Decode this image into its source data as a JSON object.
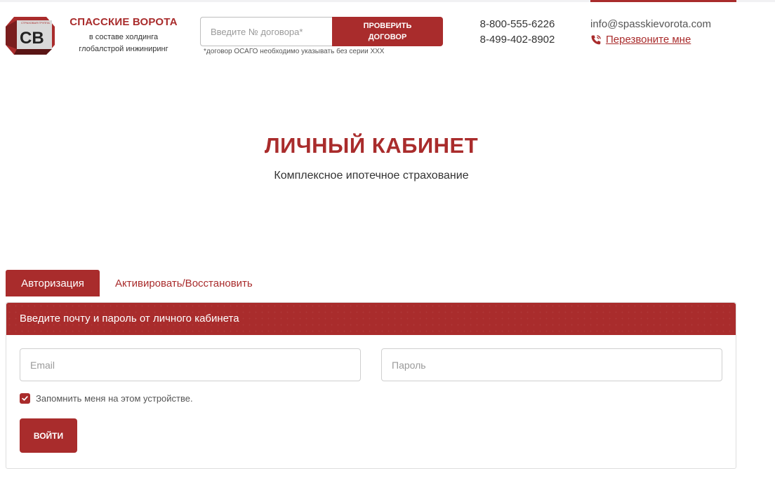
{
  "brand": {
    "logo_text": "СВ",
    "logo_small": "СТРАХОВАЯ ГРУППА",
    "title": "СПАССКИЕ ВОРОТА",
    "subtitle_line1": "в составе холдинга",
    "subtitle_line2": "глобалстрой инжиниринг",
    "color": "#a92c2c"
  },
  "contract_check": {
    "placeholder": "Введите № договора*",
    "button_line1": "ПРОВЕРИТЬ",
    "button_line2": "ДОГОВОР",
    "note": "*договор ОСАГО необходимо указывать без серии ХХХ"
  },
  "contacts": {
    "phone1": "8-800-555-6226",
    "phone2": "8-499-402-8902",
    "email": "info@spasskievorota.com",
    "callback_label": "Перезвоните мне",
    "callback_icon": "phone-icon"
  },
  "page": {
    "title": "ЛИЧНЫЙ КАБИНЕТ",
    "subtitle": "Комплексное ипотечное страхование"
  },
  "tabs": [
    {
      "label": "Авторизация",
      "active": true
    },
    {
      "label": "Активировать/Восстановить",
      "active": false
    }
  ],
  "login_form": {
    "header": "Введите почту и пароль от личного кабинета",
    "email_placeholder": "Email",
    "email_value": "",
    "password_placeholder": "Пароль",
    "password_value": "",
    "remember_label": "Запомнить меня на этом устройстве.",
    "remember_checked": true,
    "submit_label": "ВОЙТИ"
  }
}
